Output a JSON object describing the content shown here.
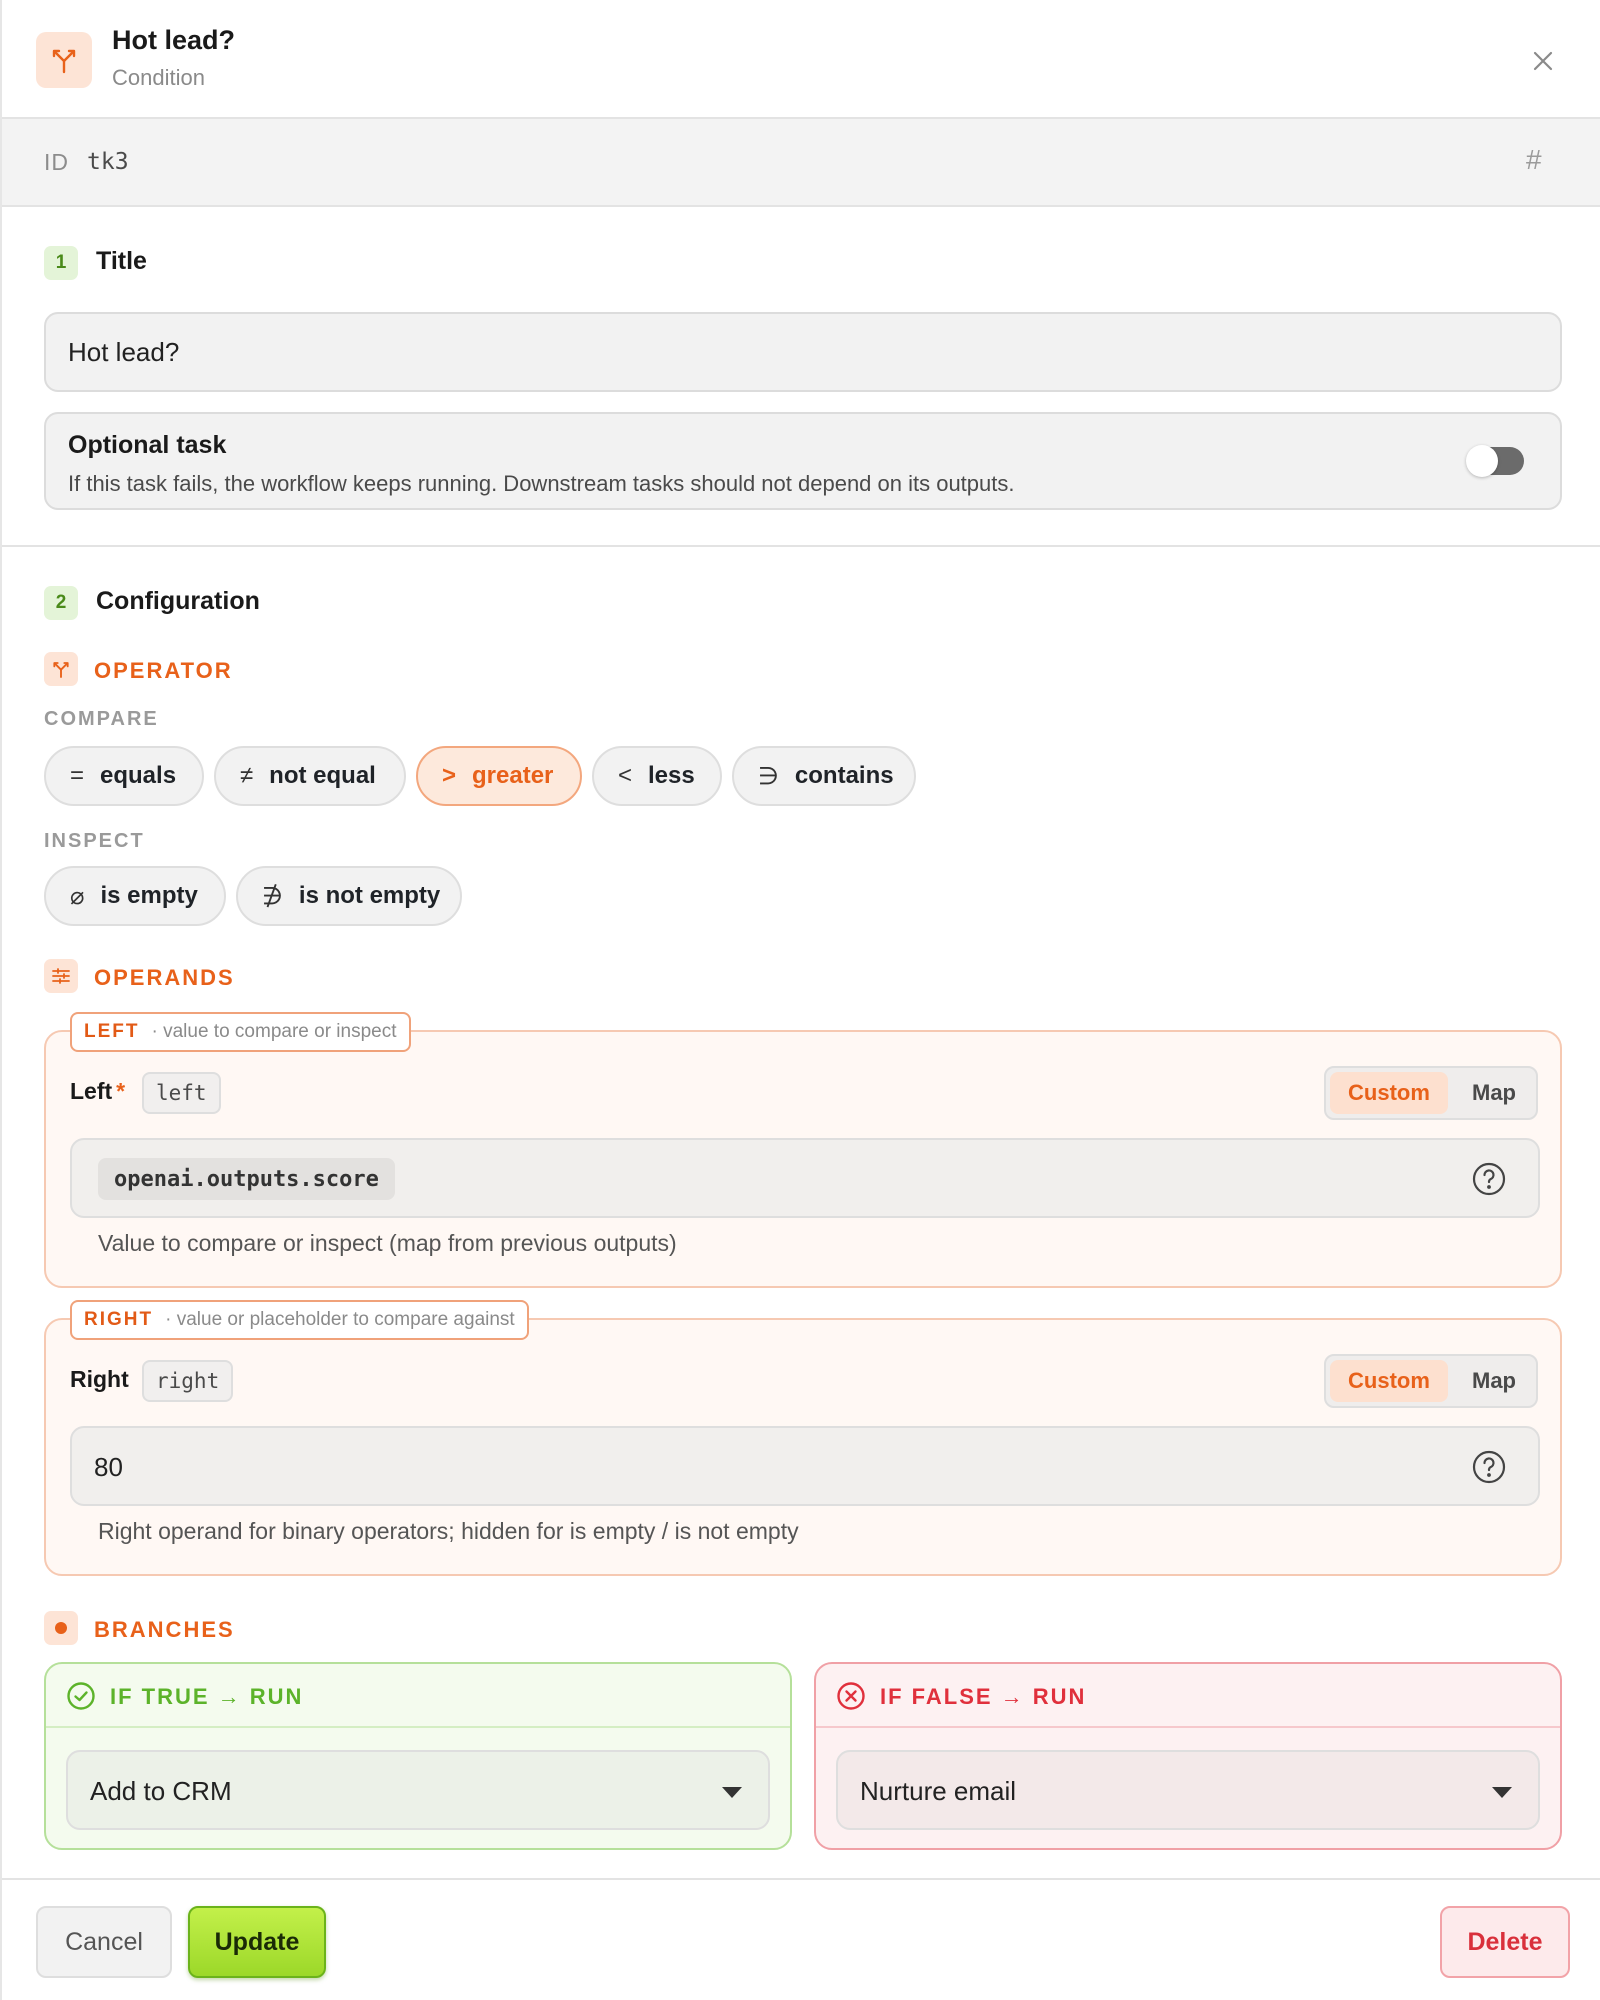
{
  "header": {
    "title": "Hot lead?",
    "subtitle": "Condition",
    "icon": "branch-fork-icon",
    "close_icon": "close-icon"
  },
  "id_bar": {
    "label": "ID",
    "value": "tk3",
    "hash_symbol": "#"
  },
  "title_section": {
    "step": "1",
    "heading": "Title",
    "title_value": "Hot lead?",
    "optional": {
      "title": "Optional task",
      "description": "If this task fails, the workflow keeps running. Downstream tasks should not depend on its outputs.",
      "enabled": false
    }
  },
  "config_section": {
    "step": "2",
    "heading": "Configuration",
    "operator": {
      "label": "OPERATOR",
      "compare_label": "COMPARE",
      "compare_options": [
        {
          "symbol": "=",
          "label": "equals"
        },
        {
          "symbol": "≠",
          "label": "not equal"
        },
        {
          "symbol": ">",
          "label": "greater",
          "selected": true
        },
        {
          "symbol": "<",
          "label": "less"
        },
        {
          "symbol": "∋",
          "label": "contains"
        }
      ],
      "inspect_label": "INSPECT",
      "inspect_options": [
        {
          "symbol": "⌀",
          "label": "is empty"
        },
        {
          "symbol": "∌",
          "label": "is not empty"
        }
      ]
    },
    "operands": {
      "label": "OPERANDS",
      "left": {
        "tag": "LEFT",
        "tag_desc": "· value to compare or inspect",
        "field_label": "Left",
        "required_mark": "*",
        "key": "left",
        "mode_custom": "Custom",
        "mode_map": "Map",
        "value": "openai.outputs.score",
        "hint": "Value to compare or inspect (map from previous outputs)"
      },
      "right": {
        "tag": "RIGHT",
        "tag_desc": "· value or placeholder to compare against",
        "field_label": "Right",
        "key": "right",
        "mode_custom": "Custom",
        "mode_map": "Map",
        "value": "80",
        "hint": "Right operand for binary operators; hidden for is empty / is not empty"
      }
    },
    "branches": {
      "label": "BRANCHES",
      "if_true": {
        "label": "IF TRUE → RUN",
        "selected": "Add to CRM"
      },
      "if_false": {
        "label": "IF FALSE → RUN",
        "selected": "Nurture email"
      }
    }
  },
  "footer": {
    "cancel": "Cancel",
    "update": "Update",
    "delete": "Delete"
  },
  "colors": {
    "accent": "#e8611a",
    "success": "#5cb32a",
    "danger": "#e0303c",
    "update_button": "#a8e034"
  }
}
